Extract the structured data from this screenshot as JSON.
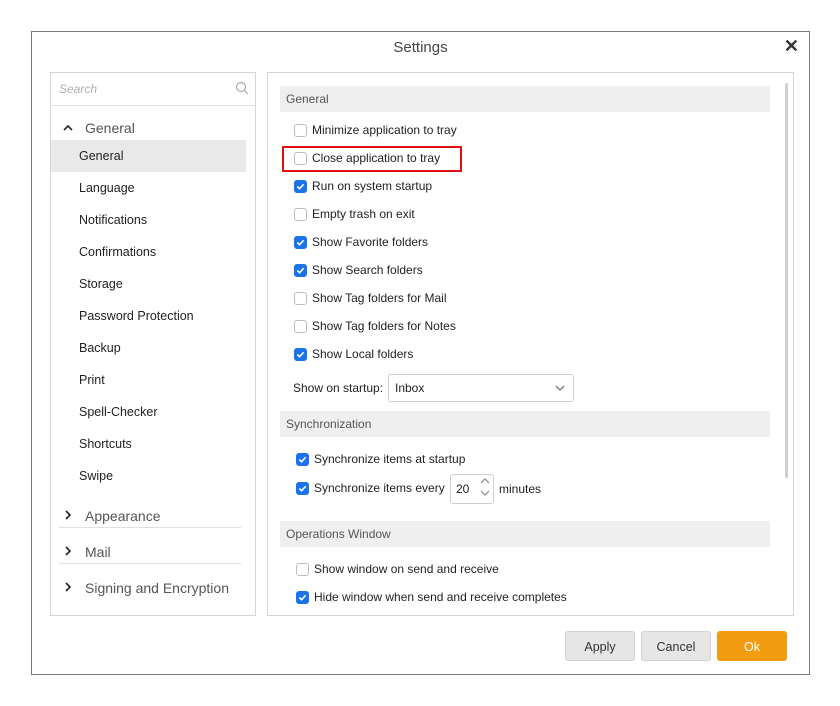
{
  "dialog": {
    "title": "Settings",
    "close_glyph": "✕"
  },
  "sidebar": {
    "search_placeholder": "Search",
    "groups": {
      "general": {
        "label": "General",
        "expanded_glyph": "⌃"
      },
      "appearance": {
        "label": "Appearance",
        "glyph": "›"
      },
      "mail": {
        "label": "Mail",
        "glyph": "›"
      },
      "signing": {
        "label": "Signing and Encryption",
        "glyph": "›"
      }
    },
    "items": [
      "General",
      "Language",
      "Notifications",
      "Confirmations",
      "Storage",
      "Password Protection",
      "Backup",
      "Print",
      "Spell-Checker",
      "Shortcuts",
      "Swipe"
    ],
    "selected": "General"
  },
  "general": {
    "header": "General",
    "options": [
      {
        "label": "Minimize application to tray",
        "checked": false
      },
      {
        "label": "Close application to tray",
        "checked": false
      },
      {
        "label": "Run on system startup",
        "checked": true
      },
      {
        "label": "Empty trash on exit",
        "checked": false
      },
      {
        "label": "Show Favorite folders",
        "checked": true
      },
      {
        "label": "Show Search folders",
        "checked": true
      },
      {
        "label": "Show Tag folders for Mail",
        "checked": false
      },
      {
        "label": "Show Tag folders for Notes",
        "checked": false
      },
      {
        "label": "Show Local folders",
        "checked": true
      }
    ],
    "startup_label": "Show on startup:",
    "startup_value": "Inbox"
  },
  "sync": {
    "header": "Synchronization",
    "at_startup": {
      "label": "Synchronize items at startup",
      "checked": true
    },
    "every": {
      "label": "Synchronize items every",
      "checked": true,
      "value": "20",
      "unit": "minutes"
    }
  },
  "ops": {
    "header": "Operations Window",
    "show": {
      "label": "Show window on send and receive",
      "checked": false
    },
    "hide": {
      "label": "Hide window when send and receive completes",
      "checked": true
    }
  },
  "buttons": {
    "apply": "Apply",
    "cancel": "Cancel",
    "ok": "Ok"
  },
  "colors": {
    "accent": "#1a73e8",
    "ok": "#f39c12",
    "highlight": "#e01010"
  }
}
